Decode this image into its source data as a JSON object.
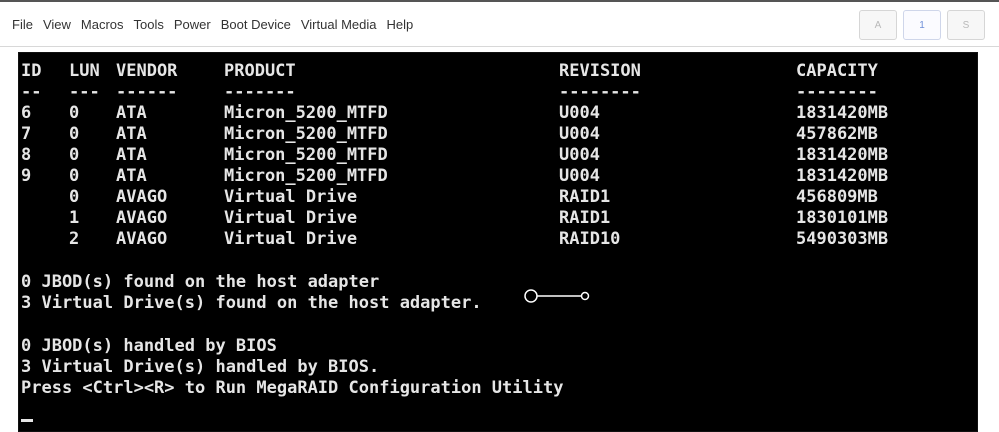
{
  "menu": [
    "File",
    "View",
    "Macros",
    "Tools",
    "Power",
    "Boot Device",
    "Virtual Media",
    "Help"
  ],
  "indicators": [
    "A",
    "1",
    "S"
  ],
  "table": {
    "headers": {
      "id": "ID",
      "lun": "LUN",
      "vendor": "VENDOR",
      "product": "PRODUCT",
      "revision": "REVISION",
      "capacity": "CAPACITY"
    },
    "dashes": {
      "id": "--",
      "lun": "---",
      "vendor": "------",
      "product": "-------",
      "revision": "--------",
      "capacity": "--------"
    },
    "rows": [
      {
        "id": "6",
        "lun": "0",
        "vendor": "ATA",
        "product": "Micron_5200_MTFD",
        "revision": "U004",
        "capacity": "1831420MB"
      },
      {
        "id": "7",
        "lun": "0",
        "vendor": "ATA",
        "product": "Micron_5200_MTFD",
        "revision": "U004",
        "capacity": "457862MB"
      },
      {
        "id": "8",
        "lun": "0",
        "vendor": "ATA",
        "product": "Micron_5200_MTFD",
        "revision": "U004",
        "capacity": "1831420MB"
      },
      {
        "id": "9",
        "lun": "0",
        "vendor": "ATA",
        "product": "Micron_5200_MTFD",
        "revision": "U004",
        "capacity": "1831420MB"
      },
      {
        "id": "",
        "lun": "0",
        "vendor": "AVAGO",
        "product": "Virtual Drive",
        "revision": "RAID1",
        "capacity": "456809MB"
      },
      {
        "id": "",
        "lun": "1",
        "vendor": "AVAGO",
        "product": "Virtual Drive",
        "revision": "RAID1",
        "capacity": "1830101MB"
      },
      {
        "id": "",
        "lun": "2",
        "vendor": "AVAGO",
        "product": "Virtual Drive",
        "revision": "RAID10",
        "capacity": "5490303MB"
      }
    ]
  },
  "messages": [
    "0 JBOD(s) found on the host adapter",
    "3 Virtual Drive(s) found on the host adapter.",
    "0 JBOD(s) handled by BIOS",
    "3 Virtual Drive(s) handled by BIOS.",
    "Press <Ctrl><R> to Run MegaRAID Configuration Utility"
  ],
  "colors": {
    "console_bg": "#000000",
    "console_text": "#e6e6e6",
    "menu_text": "#333333"
  }
}
